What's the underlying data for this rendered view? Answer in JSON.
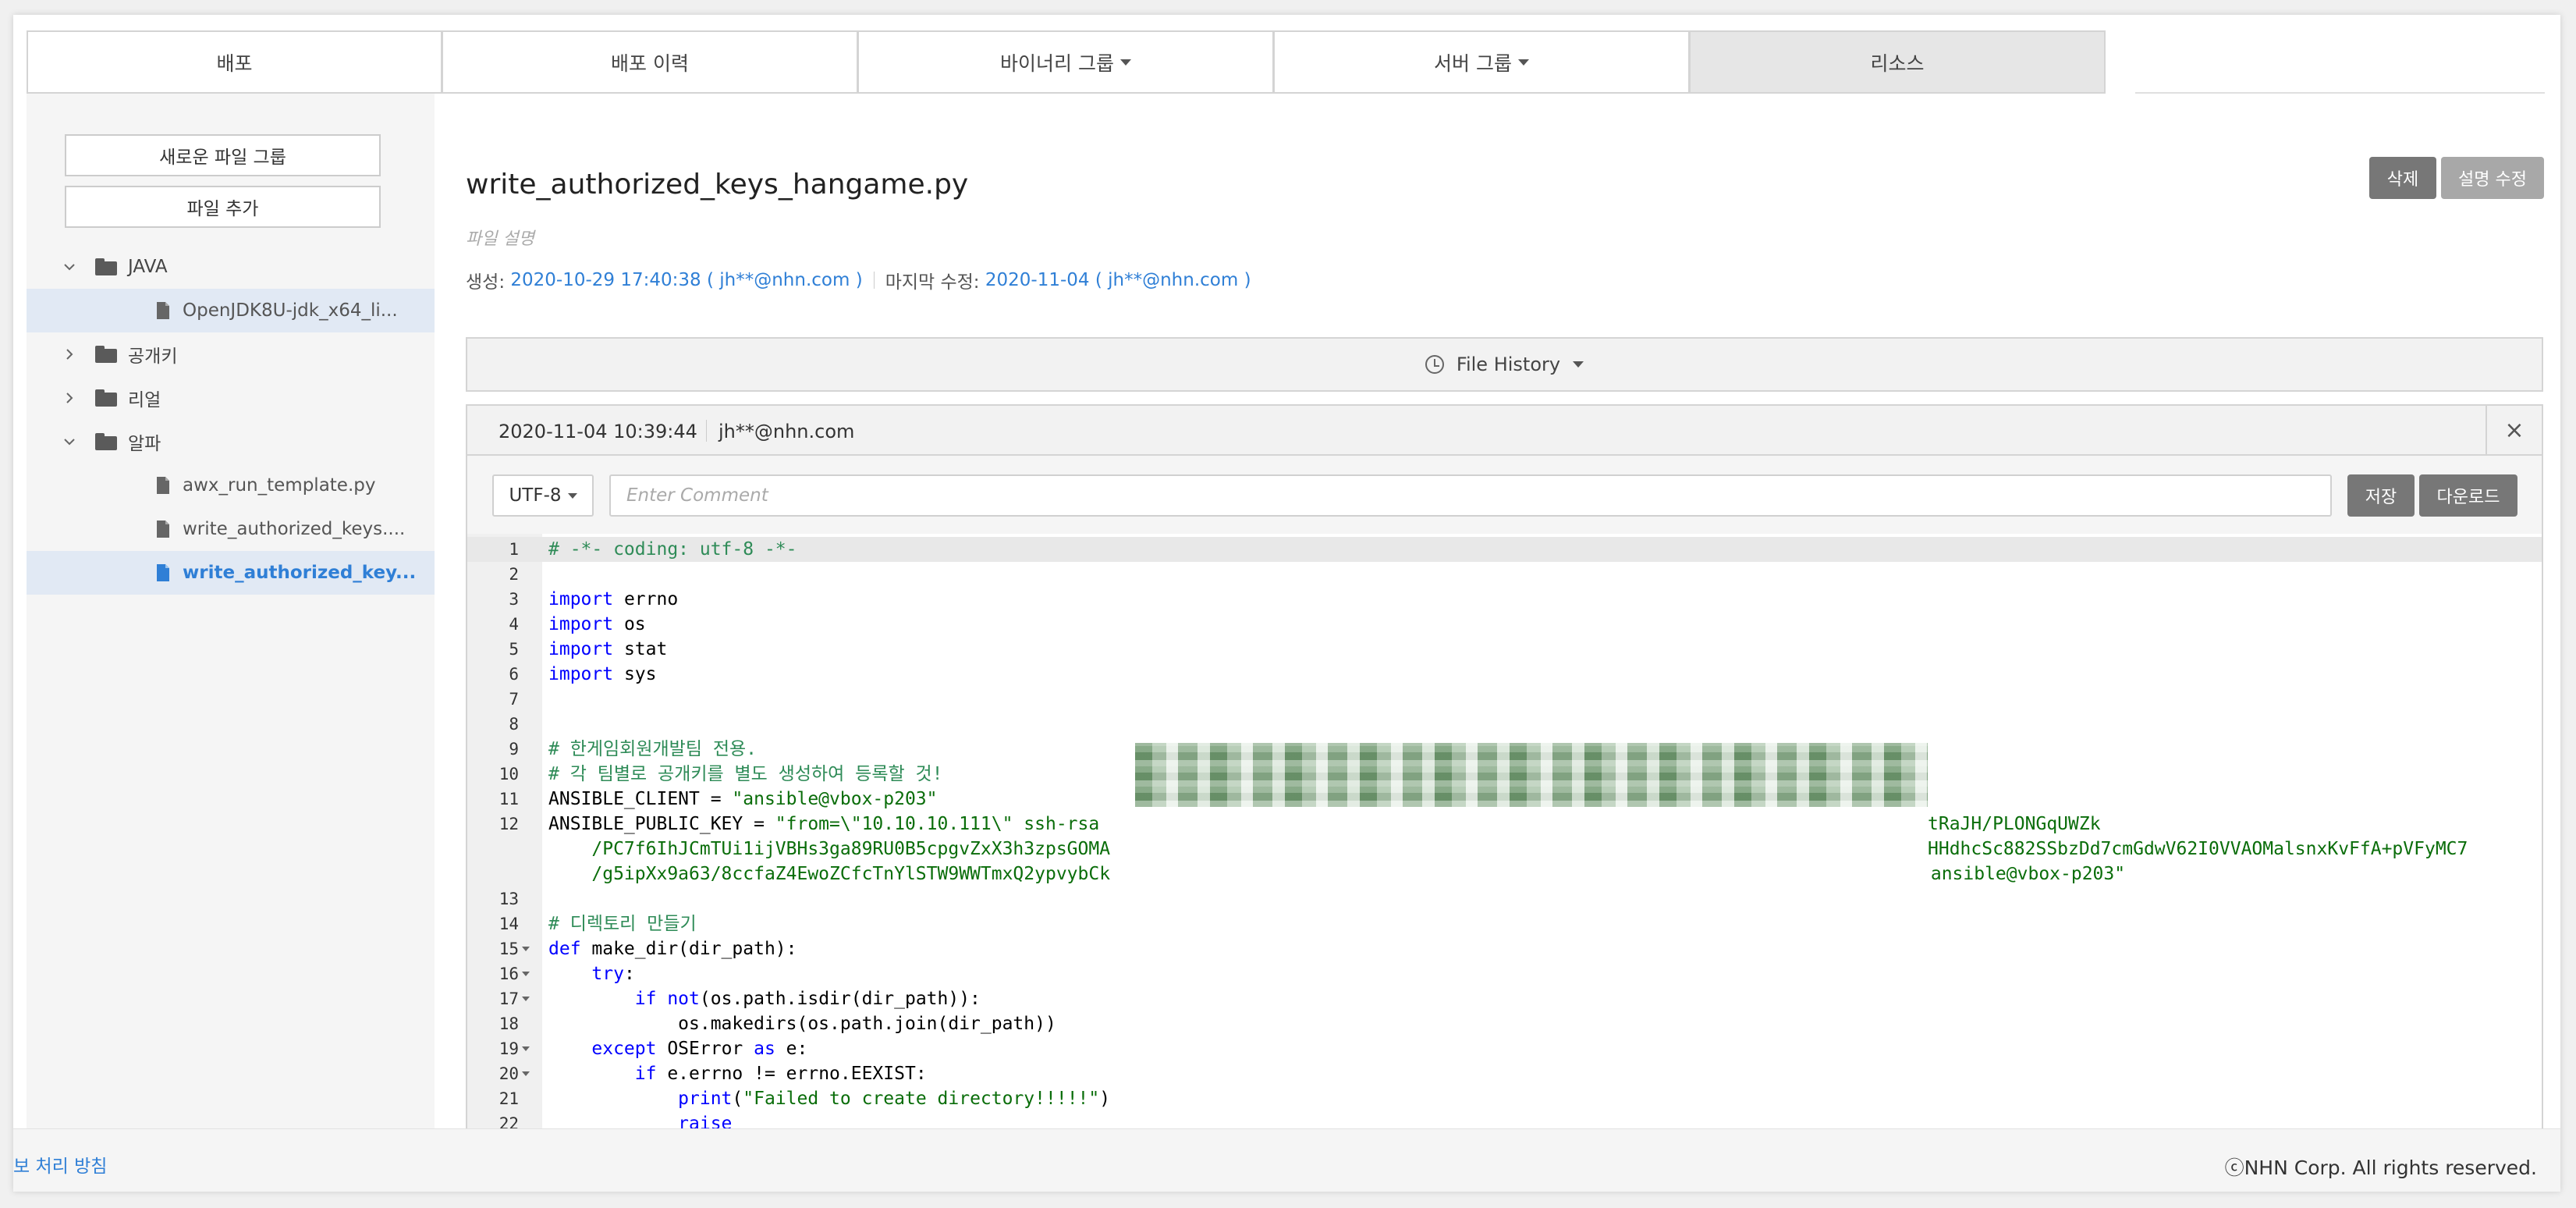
{
  "tabs": [
    {
      "label": "배포",
      "caret": false,
      "active": false
    },
    {
      "label": "배포 이력",
      "caret": false,
      "active": false
    },
    {
      "label": "바이너리 그룹",
      "caret": true,
      "active": false
    },
    {
      "label": "서버 그룹",
      "caret": true,
      "active": false
    },
    {
      "label": "리소스",
      "caret": false,
      "active": true
    }
  ],
  "sidebar": {
    "new_file_group": "새로운 파일 그룹",
    "add_file": "파일 추가",
    "tree": [
      {
        "type": "folder",
        "label": "JAVA",
        "expanded": true
      },
      {
        "type": "file",
        "label": "OpenJDK8U-jdk_x64_li...",
        "selected": true
      },
      {
        "type": "folder",
        "label": "공개키",
        "expanded": false
      },
      {
        "type": "folder",
        "label": "리얼",
        "expanded": false
      },
      {
        "type": "folder",
        "label": "알파",
        "expanded": true
      },
      {
        "type": "file",
        "label": "awx_run_template.py"
      },
      {
        "type": "file",
        "label": "write_authorized_keys...."
      },
      {
        "type": "file",
        "label": "write_authorized_key...",
        "active": true
      }
    ]
  },
  "file": {
    "title": "write_authorized_keys_hangame.py",
    "description_placeholder": "파일 설명",
    "created_label": "생성:",
    "created_value": "2020-10-29 17:40:38 ( jh**@nhn.com )",
    "modified_label": "마지막 수정:",
    "modified_value": "2020-11-04 ( jh**@nhn.com )"
  },
  "actions": {
    "delete": "삭제",
    "edit_desc": "설명 수정",
    "delete_color": "#777777",
    "edit_color": "#a8a8a8"
  },
  "history": {
    "label": "File History"
  },
  "editor": {
    "date": "2020-11-04 10:39:44",
    "user": "jh**@nhn.com",
    "close": "×",
    "encoding": "UTF-8",
    "comment_placeholder": "Enter Comment",
    "save": "저장",
    "download": "다운로드"
  },
  "code_lines": [
    {
      "n": "1",
      "segs": [
        {
          "c": "cmt",
          "t": "# -*- coding: utf-8 -*-"
        }
      ],
      "cur": true
    },
    {
      "n": "2",
      "segs": []
    },
    {
      "n": "3",
      "segs": [
        {
          "c": "kw",
          "t": "import"
        },
        {
          "c": "",
          "t": " errno"
        }
      ]
    },
    {
      "n": "4",
      "segs": [
        {
          "c": "kw",
          "t": "import"
        },
        {
          "c": "",
          "t": " os"
        }
      ]
    },
    {
      "n": "5",
      "segs": [
        {
          "c": "kw",
          "t": "import"
        },
        {
          "c": "",
          "t": " stat"
        }
      ]
    },
    {
      "n": "6",
      "segs": [
        {
          "c": "kw",
          "t": "import"
        },
        {
          "c": "",
          "t": " sys"
        }
      ]
    },
    {
      "n": "7",
      "segs": []
    },
    {
      "n": "8",
      "segs": []
    },
    {
      "n": "9",
      "segs": [
        {
          "c": "cmt",
          "t": "# 한게임회원개발팀 전용."
        }
      ]
    },
    {
      "n": "10",
      "segs": [
        {
          "c": "cmt",
          "t": "# 각 팀별로 공개키를 별도 생성하여 등록할 것!"
        }
      ]
    },
    {
      "n": "11",
      "segs": [
        {
          "c": "",
          "t": "ANSIBLE_CLIENT = "
        },
        {
          "c": "str",
          "t": "\"ansible@vbox-p203\""
        }
      ]
    },
    {
      "n": "12",
      "segs": [
        {
          "c": "",
          "t": "ANSIBLE_PUBLIC_KEY = "
        },
        {
          "c": "str",
          "t": "\"from=\\\"10.10.10.111\\\" ssh-rsa"
        }
      ],
      "tail": "tRaJH/PLONGqUWZk"
    },
    {
      "n": "",
      "segs": [
        {
          "c": "str",
          "t": "    /PC7f6IhJCmTUi1ijVBHs3ga89RU0B5cpgvZxX3h3zpsGOMA"
        }
      ],
      "tail": "HHdhcSc882SSbzDd7cmGdwV62I0VVAOMalsnxKvFfA+pVFyMC7"
    },
    {
      "n": "",
      "segs": [
        {
          "c": "str",
          "t": "    /g5ipXx9a63/8ccfaZ4EwoZCfcTnYlSTW9WWTmxQ2ypvybCk"
        }
      ],
      "tail": " ansible@vbox-p203\""
    },
    {
      "n": "13",
      "segs": []
    },
    {
      "n": "14",
      "segs": [
        {
          "c": "cmt",
          "t": "# 디렉토리 만들기"
        }
      ]
    },
    {
      "n": "15",
      "fold": true,
      "segs": [
        {
          "c": "kw",
          "t": "def"
        },
        {
          "c": "",
          "t": " make_dir(dir_path):"
        }
      ]
    },
    {
      "n": "16",
      "fold": true,
      "segs": [
        {
          "c": "",
          "t": "    "
        },
        {
          "c": "kw",
          "t": "try"
        },
        {
          "c": "",
          "t": ":"
        }
      ]
    },
    {
      "n": "17",
      "fold": true,
      "segs": [
        {
          "c": "",
          "t": "        "
        },
        {
          "c": "kw",
          "t": "if not"
        },
        {
          "c": "",
          "t": "(os.path.isdir(dir_path)):"
        }
      ]
    },
    {
      "n": "18",
      "segs": [
        {
          "c": "",
          "t": "            os.makedirs(os.path.join(dir_path))"
        }
      ]
    },
    {
      "n": "19",
      "fold": true,
      "segs": [
        {
          "c": "",
          "t": "    "
        },
        {
          "c": "kw",
          "t": "except"
        },
        {
          "c": "",
          "t": " OSError "
        },
        {
          "c": "kw",
          "t": "as"
        },
        {
          "c": "",
          "t": " e:"
        }
      ]
    },
    {
      "n": "20",
      "fold": true,
      "segs": [
        {
          "c": "",
          "t": "        "
        },
        {
          "c": "kw",
          "t": "if"
        },
        {
          "c": "",
          "t": " e.errno != errno.EEXIST:"
        }
      ]
    },
    {
      "n": "21",
      "segs": [
        {
          "c": "",
          "t": "            "
        },
        {
          "c": "kw",
          "t": "print"
        },
        {
          "c": "",
          "t": "("
        },
        {
          "c": "str",
          "t": "\"Failed to create directory!!!!!\""
        },
        {
          "c": "",
          "t": ")"
        }
      ]
    },
    {
      "n": "22",
      "segs": [
        {
          "c": "",
          "t": "            "
        },
        {
          "c": "kw",
          "t": "raise"
        }
      ]
    }
  ],
  "footer": {
    "privacy": "보 처리 방침",
    "copyright": "ⓒNHN Corp. All rights reserved."
  }
}
